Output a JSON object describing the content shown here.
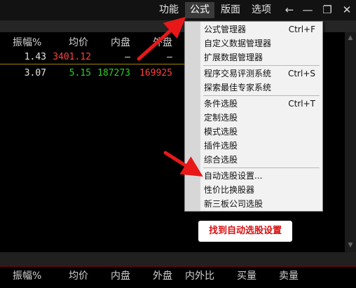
{
  "menubar": {
    "items": [
      "功能",
      "公式",
      "版面",
      "选项"
    ],
    "active_index": 1,
    "controls": [
      "←",
      "—",
      "❐",
      "✕"
    ]
  },
  "table_top": {
    "headers": [
      "振幅%",
      "均价",
      "内盘",
      "外盘"
    ],
    "rows": [
      [
        "1.43",
        "3401.12",
        "–",
        "–"
      ],
      [
        "3.07",
        "5.15",
        "187273",
        "169925"
      ]
    ]
  },
  "table_bottom": {
    "headers": [
      "振幅%",
      "均价",
      "内盘",
      "外盘",
      "内外比",
      "买量",
      "卖量"
    ]
  },
  "dropdown": {
    "items": [
      {
        "label": "公式管理器",
        "shortcut": "Ctrl+F"
      },
      {
        "label": "自定义数据管理器",
        "shortcut": ""
      },
      {
        "label": "扩展数据管理器",
        "shortcut": ""
      },
      {
        "label": "程序交易评测系统",
        "shortcut": "Ctrl+S"
      },
      {
        "label": "探索最佳专家系统",
        "shortcut": ""
      },
      {
        "label": "条件选股",
        "shortcut": "Ctrl+T"
      },
      {
        "label": "定制选股",
        "shortcut": ""
      },
      {
        "label": "模式选股",
        "shortcut": ""
      },
      {
        "label": "插件选股",
        "shortcut": ""
      },
      {
        "label": "综合选股",
        "shortcut": ""
      },
      {
        "label": "自动选股设置...",
        "shortcut": ""
      },
      {
        "label": "性价比换股器",
        "shortcut": ""
      },
      {
        "label": "新三板公司选股",
        "shortcut": ""
      }
    ]
  },
  "annotation": {
    "callout_text": "找到自动选股设置",
    "arrow_color": "#e81818"
  },
  "colors": {
    "up": "#ff4040",
    "down": "#28d028",
    "menu_bg": "#f2f2f2",
    "background": "#000000"
  }
}
